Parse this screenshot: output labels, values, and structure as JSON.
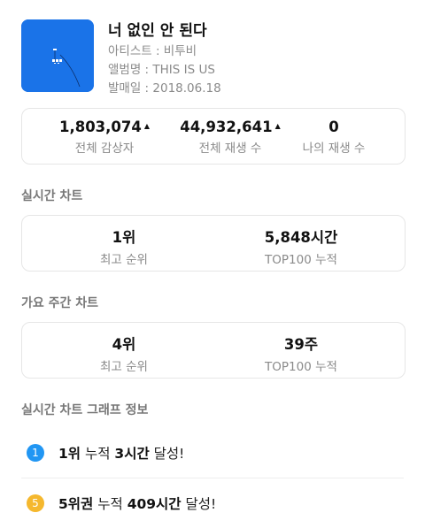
{
  "song": {
    "title": "너 없인 안 된다",
    "artist_line": "아티스트 : 비투비",
    "album_line": "앨범명 : THIS IS US",
    "release_line": "발매일 : 2018.06.18",
    "art_color": "#1a73e8"
  },
  "totals": [
    {
      "value": "1,803,074",
      "label": "전체 감상자",
      "trend": "up"
    },
    {
      "value": "44,932,641",
      "label": "전체 재생 수",
      "trend": "up"
    },
    {
      "value": "0",
      "label": "나의 재생 수",
      "trend": ""
    }
  ],
  "realtime_chart": {
    "title": "실시간 차트",
    "stats": [
      {
        "value": "1위",
        "label": "최고 순위"
      },
      {
        "value": "5,848시간",
        "label": "TOP100 누적"
      }
    ]
  },
  "weekly_chart": {
    "title": "가요 주간 차트",
    "stats": [
      {
        "value": "4위",
        "label": "최고 순위"
      },
      {
        "value": "39주",
        "label": "TOP100 누적"
      }
    ]
  },
  "graph_info": {
    "title": "실시간 차트 그래프 정보",
    "rows": [
      {
        "badge": "1",
        "badge_color": "#2196f3",
        "strong1": "1위",
        "mid": " 누적 ",
        "strong2": "3시간",
        "tail": " 달성!"
      },
      {
        "badge": "5",
        "badge_color": "#f5b82e",
        "strong1": "5위권",
        "mid": " 누적 ",
        "strong2": "409시간",
        "tail": " 달성!"
      }
    ]
  }
}
